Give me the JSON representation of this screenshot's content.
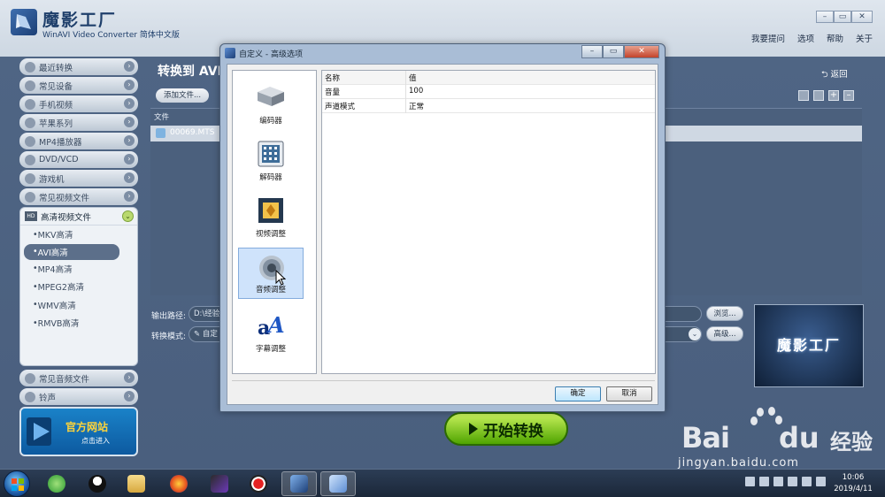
{
  "app": {
    "title": "魔影工厂",
    "subtitle": "WinAVI Video Converter 简体中文版",
    "menu": [
      "我要提问",
      "选项",
      "帮助",
      "关于"
    ]
  },
  "sidebar": {
    "categories": [
      "最近转换",
      "常见设备",
      "手机视频",
      "苹果系列",
      "MP4播放器",
      "DVD/VCD",
      "游戏机",
      "常见视频文件"
    ],
    "open_category": "高清视频文件",
    "subitems": [
      "MKV高清",
      "AVI高清",
      "MP4高清",
      "MPEG2高清",
      "WMV高清",
      "RMVB高清"
    ],
    "selected_subitem": "AVI高清",
    "bottom_categories": [
      "常见音频文件",
      "铃声"
    ],
    "site_title": "官方网站",
    "site_sub": "点击进入"
  },
  "main": {
    "title": "转换到 AVI",
    "back_label": "返回",
    "add_file_label": "添加文件...",
    "file_column_header": "文件",
    "file_name": "00069.MTS",
    "output_label": "输出路径:",
    "output_value": "D:\\经验",
    "mode_label": "转换模式:",
    "mode_value": "自定",
    "browse_label": "浏览...",
    "advanced_label": "高级...",
    "preview_brand": "魔影工厂",
    "start_label": "开始转换"
  },
  "dialog": {
    "title": "自定义 - 高级选项",
    "nav": [
      {
        "label": "编码器",
        "icon": "encoder-icon"
      },
      {
        "label": "解码器",
        "icon": "decoder-icon"
      },
      {
        "label": "视频调整",
        "icon": "video-adjust-icon"
      },
      {
        "label": "音频调整",
        "icon": "audio-adjust-icon"
      },
      {
        "label": "字幕调整",
        "icon": "subtitle-adjust-icon"
      }
    ],
    "selected_nav": "音频调整",
    "table": {
      "headers": [
        "名称",
        "值"
      ],
      "rows": [
        {
          "name": "音量",
          "value": "100"
        },
        {
          "name": "声道模式",
          "value": "正常"
        }
      ]
    },
    "ok_label": "确定",
    "cancel_label": "取消"
  },
  "watermark": {
    "bai": "Bai",
    "du": "du",
    "jingyan": "经验",
    "url": "jingyan.baidu.com"
  },
  "taskbar": {
    "time": "10:06",
    "date": "2019/4/11"
  },
  "colors": {
    "accent_blue": "#4a5f7e",
    "start_green": "#4fa400",
    "site_yellow": "#ffd43a",
    "selection_blue": "#cfe3fb"
  }
}
